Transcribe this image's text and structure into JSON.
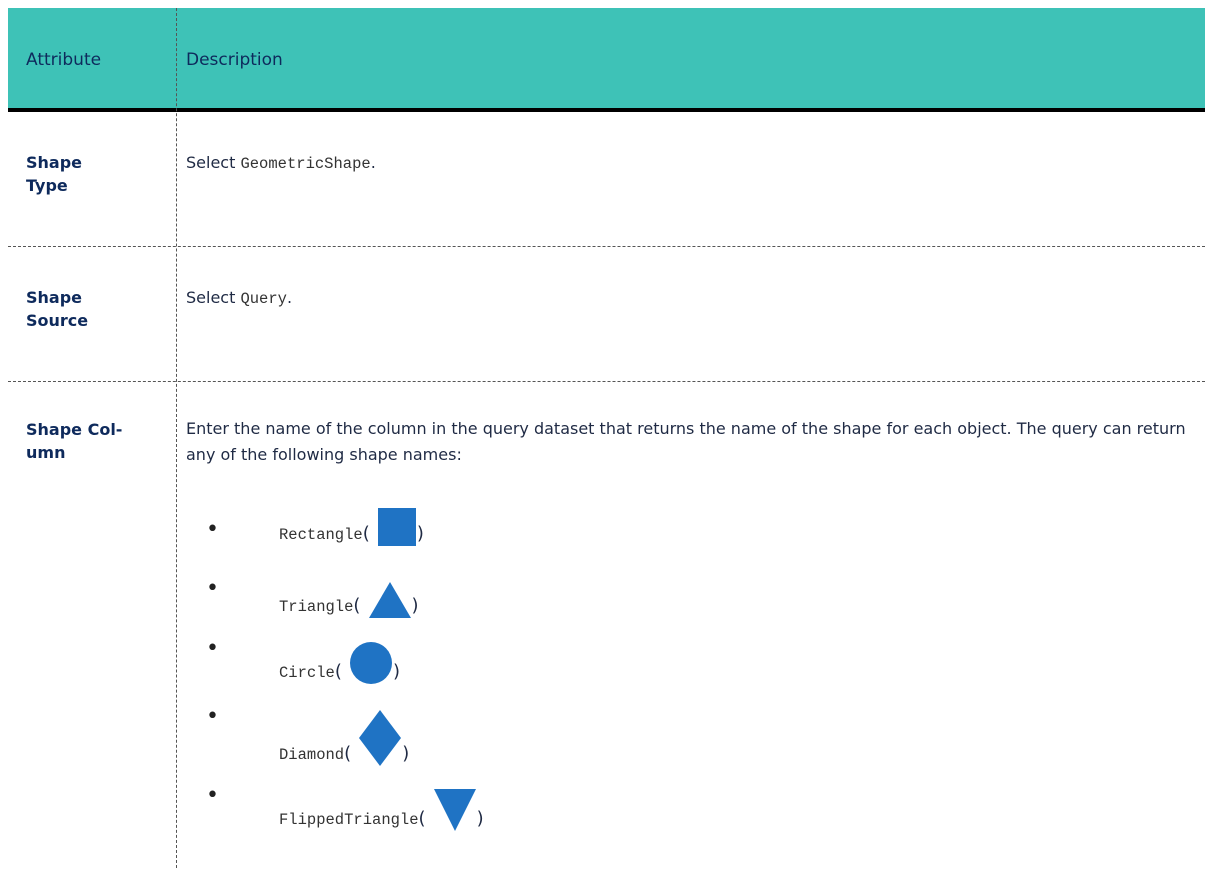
{
  "header": {
    "col_attribute": "Attribute",
    "col_description": "Description"
  },
  "rows": [
    {
      "attribute": "Shape Type",
      "desc_prefix": "Select ",
      "desc_code": "GeometricShape",
      "desc_suffix": "."
    },
    {
      "attribute": "Shape Source",
      "desc_prefix": "Select ",
      "desc_code": "Query",
      "desc_suffix": "."
    },
    {
      "attribute": "Shape Col-umn",
      "description": "Enter the name of the column in the query dataset that returns the name of the shape for each object. The query can return any of the following shape names:",
      "shapes": [
        {
          "name": "Rectangle",
          "icon": "square-icon"
        },
        {
          "name": "Triangle",
          "icon": "triangle-icon"
        },
        {
          "name": "Circle",
          "icon": "circle-icon"
        },
        {
          "name": "Diamond",
          "icon": "diamond-icon"
        },
        {
          "name": "FlippedTriangle",
          "icon": "flipped-triangle-icon"
        }
      ]
    }
  ],
  "bullet_char": "•",
  "open_paren": "(",
  "close_paren": ")",
  "colors": {
    "header_bg": "#3ec2b7",
    "header_text": "#0e2a5c",
    "shape_fill": "#1f73c4"
  }
}
